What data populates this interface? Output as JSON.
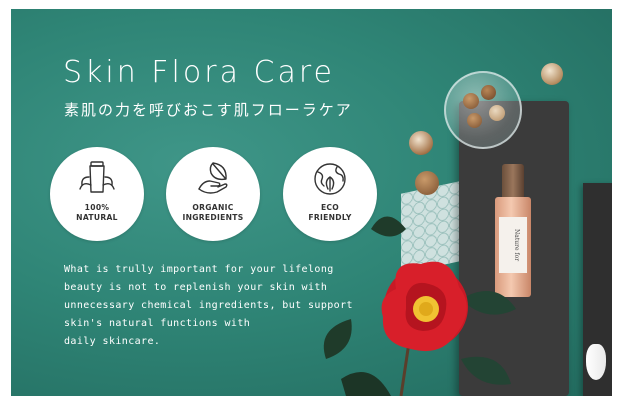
{
  "banner": {
    "title": "Skin Flora Care",
    "subtitle": "素肌の力を呼びおこす肌フローラケア",
    "badges": [
      {
        "icon": "tube-leaf-icon",
        "line1": "100%",
        "line2": "NATURAL"
      },
      {
        "icon": "hand-leaf-icon",
        "line1": "ORGANIC",
        "line2": "INGREDIENTS"
      },
      {
        "icon": "globe-leaf-icon",
        "line1": "ECO",
        "line2": "FRIENDLY"
      }
    ],
    "description_lines": [
      "What is trully important for your lifelong",
      "beauty is not to replenish your skin with",
      "unnecessary chemical ingredients, but support",
      "skin's natural functions with",
      "daily skincare."
    ],
    "product_label": "Nature for"
  },
  "colors": {
    "background_teal": "#2f8576",
    "badge_white": "#ffffff",
    "camellia_red": "#d81f2a",
    "slate": "#3b3b3b"
  }
}
